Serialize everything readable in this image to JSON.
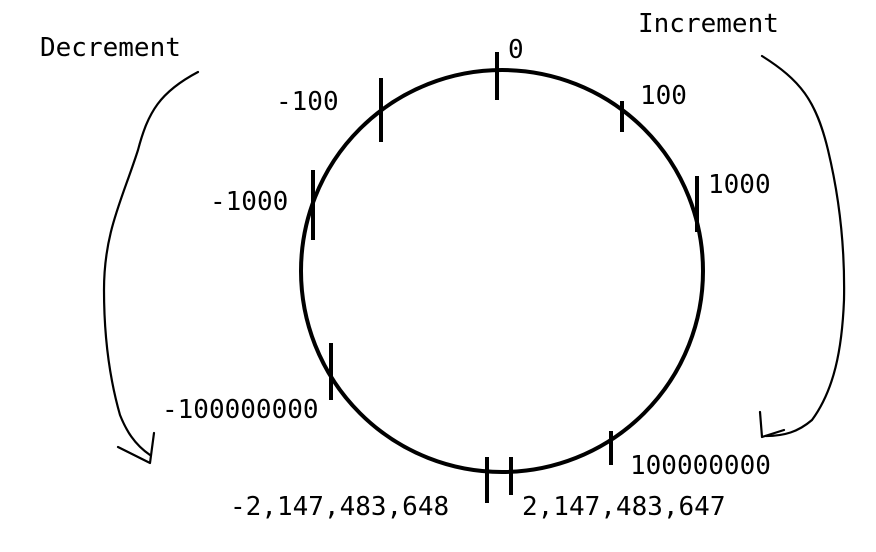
{
  "directions": {
    "decrement": "Decrement",
    "increment": "Increment"
  },
  "ring_labels": {
    "zero": "0",
    "pos_100": "100",
    "pos_1000": "1000",
    "pos_100000000": "100000000",
    "max_int": "2,147,483,647",
    "min_int": "-2,147,483,648",
    "neg_100000000": "-100000000",
    "neg_1000": "-1000",
    "neg_100": "-100"
  }
}
